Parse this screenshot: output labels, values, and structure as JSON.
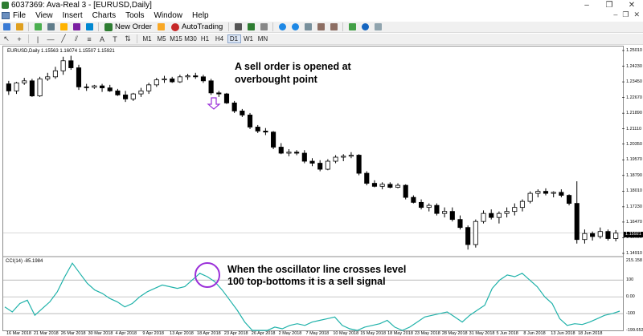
{
  "window": {
    "title": "6037369: Ava-Real 3 - [EURUSD,Daily]",
    "minimize": "–",
    "restore": "❐",
    "close": "✕"
  },
  "menu": {
    "items": [
      "File",
      "View",
      "Insert",
      "Charts",
      "Tools",
      "Window",
      "Help"
    ]
  },
  "toolbar": {
    "new_order": "New Order",
    "autotrading": "AutoTrading",
    "timeframes": [
      "M1",
      "M5",
      "M15",
      "M30",
      "H1",
      "H4",
      "D1",
      "W1",
      "MN"
    ],
    "active_timeframe": "D1"
  },
  "chart": {
    "info": "EURUSD,Daily  1.15563 1.16074 1.15507 1.15921",
    "cci_info": "CCI(14) -85.1984",
    "last_price": "1.15921",
    "annotation_top": [
      "A sell order is opened at",
      "overbought point"
    ],
    "annotation_bottom": [
      "When the oscillator line crosses level",
      "100 top-bottoms it is a sell signal"
    ],
    "price_ticks": [
      "1.25010",
      "1.24230",
      "1.23450",
      "1.22670",
      "1.21890",
      "1.21110",
      "1.20350",
      "1.19570",
      "1.18790",
      "1.18010",
      "1.17230",
      "1.16470",
      "1.15690",
      "1.14910"
    ],
    "cci_ticks": [
      "215.158",
      "100",
      "0.00",
      "-100",
      "-199.653"
    ],
    "date_ticks": [
      "16 Mar 2018",
      "21 Mar 2018",
      "26 Mar 2018",
      "30 Mar 2018",
      "4 Apr 2018",
      "9 Apr 2018",
      "13 Apr 2018",
      "18 Apr 2018",
      "23 Apr 2018",
      "26 Apr 2018",
      "2 May 2018",
      "7 May 2018",
      "10 May 2018",
      "15 May 2018",
      "18 May 2018",
      "23 May 2018",
      "28 May 2018",
      "31 May 2018",
      "5 Jun 2018",
      "8 Jun 2018",
      "13 Jun 2018",
      "18 Jun 2018"
    ]
  },
  "chart_data": {
    "type": "candlestick",
    "symbol": "EURUSD",
    "timeframe": "Daily",
    "ylim": [
      1.1491,
      1.2501
    ],
    "candles": [
      [
        1.2335,
        1.235,
        1.228,
        1.23
      ],
      [
        1.23,
        1.2345,
        1.2285,
        1.234
      ],
      [
        1.234,
        1.2365,
        1.233,
        1.235
      ],
      [
        1.235,
        1.236,
        1.227,
        1.2275
      ],
      [
        1.2275,
        1.237,
        1.227,
        1.236
      ],
      [
        1.236,
        1.239,
        1.235,
        1.237
      ],
      [
        1.237,
        1.242,
        1.236,
        1.24
      ],
      [
        1.24,
        1.247,
        1.238,
        1.245
      ],
      [
        1.245,
        1.2475,
        1.2405,
        1.2415
      ],
      [
        1.2415,
        1.243,
        1.2305,
        1.232
      ],
      [
        1.232,
        1.2335,
        1.23,
        1.2318
      ],
      [
        1.2318,
        1.233,
        1.231,
        1.2325
      ],
      [
        1.2325,
        1.2335,
        1.2295,
        1.2315
      ],
      [
        1.2315,
        1.233,
        1.2295,
        1.23
      ],
      [
        1.23,
        1.231,
        1.2275,
        1.228
      ],
      [
        1.228,
        1.23,
        1.2245,
        1.226
      ],
      [
        1.226,
        1.229,
        1.225,
        1.2285
      ],
      [
        1.2285,
        1.2315,
        1.227,
        1.23
      ],
      [
        1.23,
        1.234,
        1.2285,
        1.233
      ],
      [
        1.233,
        1.2365,
        1.232,
        1.2355
      ],
      [
        1.2355,
        1.2375,
        1.234,
        1.236
      ],
      [
        1.236,
        1.237,
        1.234,
        1.2345
      ],
      [
        1.2345,
        1.238,
        1.234,
        1.237
      ],
      [
        1.237,
        1.2385,
        1.2355,
        1.2375
      ],
      [
        1.2375,
        1.239,
        1.236,
        1.237
      ],
      [
        1.237,
        1.238,
        1.234,
        1.235
      ],
      [
        1.235,
        1.236,
        1.228,
        1.229
      ],
      [
        1.229,
        1.23,
        1.227,
        1.2285
      ],
      [
        1.2285,
        1.229,
        1.2235,
        1.224
      ],
      [
        1.224,
        1.225,
        1.219,
        1.22
      ],
      [
        1.22,
        1.221,
        1.217,
        1.218
      ],
      [
        1.218,
        1.219,
        1.211,
        1.212
      ],
      [
        1.212,
        1.213,
        1.209,
        1.21
      ],
      [
        1.21,
        1.2115,
        1.208,
        1.2095
      ],
      [
        1.2095,
        1.21,
        1.201,
        1.202
      ],
      [
        1.202,
        1.204,
        1.1985,
        1.199
      ],
      [
        1.199,
        1.201,
        1.1975,
        1.1995
      ],
      [
        1.1995,
        1.2005,
        1.198,
        1.199
      ],
      [
        1.199,
        1.2005,
        1.194,
        1.195
      ],
      [
        1.195,
        1.1965,
        1.1925,
        1.194
      ],
      [
        1.194,
        1.1955,
        1.19,
        1.191
      ],
      [
        1.191,
        1.196,
        1.1905,
        1.195
      ],
      [
        1.195,
        1.198,
        1.194,
        1.197
      ],
      [
        1.197,
        1.1985,
        1.195,
        1.1975
      ],
      [
        1.1975,
        1.1995,
        1.1965,
        1.198
      ],
      [
        1.198,
        1.1985,
        1.188,
        1.189
      ],
      [
        1.189,
        1.19,
        1.183,
        1.184
      ],
      [
        1.184,
        1.1855,
        1.182,
        1.1825
      ],
      [
        1.1825,
        1.1845,
        1.181,
        1.1835
      ],
      [
        1.1835,
        1.1845,
        1.1815,
        1.182
      ],
      [
        1.182,
        1.184,
        1.1815,
        1.183
      ],
      [
        1.183,
        1.1835,
        1.176,
        1.177
      ],
      [
        1.177,
        1.178,
        1.174,
        1.1745
      ],
      [
        1.1745,
        1.176,
        1.171,
        1.172
      ],
      [
        1.172,
        1.174,
        1.17,
        1.173
      ],
      [
        1.173,
        1.174,
        1.168,
        1.169
      ],
      [
        1.169,
        1.172,
        1.167,
        1.17
      ],
      [
        1.17,
        1.172,
        1.165,
        1.166
      ],
      [
        1.166,
        1.168,
        1.161,
        1.162
      ],
      [
        1.162,
        1.163,
        1.151,
        1.1535
      ],
      [
        1.1535,
        1.166,
        1.152,
        1.165
      ],
      [
        1.165,
        1.1705,
        1.164,
        1.169
      ],
      [
        1.169,
        1.171,
        1.166,
        1.167
      ],
      [
        1.167,
        1.17,
        1.164,
        1.169
      ],
      [
        1.169,
        1.172,
        1.167,
        1.17
      ],
      [
        1.17,
        1.174,
        1.168,
        1.172
      ],
      [
        1.172,
        1.176,
        1.17,
        1.175
      ],
      [
        1.175,
        1.18,
        1.174,
        1.179
      ],
      [
        1.179,
        1.181,
        1.177,
        1.18
      ],
      [
        1.18,
        1.1815,
        1.178,
        1.179
      ],
      [
        1.179,
        1.18,
        1.177,
        1.1795
      ],
      [
        1.1795,
        1.181,
        1.177,
        1.178
      ],
      [
        1.178,
        1.1785,
        1.173,
        1.174
      ],
      [
        1.174,
        1.185,
        1.154,
        1.156
      ],
      [
        1.156,
        1.161,
        1.154,
        1.159
      ],
      [
        1.159,
        1.16,
        1.1555,
        1.1575
      ],
      [
        1.1575,
        1.162,
        1.1565,
        1.16
      ],
      [
        1.16,
        1.161,
        1.1555,
        1.1565
      ],
      [
        1.1565,
        1.1607,
        1.1551,
        1.1592
      ]
    ],
    "cci": {
      "name": "CCI(14)",
      "levels": [
        100,
        0,
        -100
      ],
      "ylim": [
        -199.653,
        215.158
      ],
      "values": [
        -60,
        -90,
        -40,
        -20,
        -110,
        -70,
        -30,
        30,
        120,
        200,
        140,
        80,
        40,
        20,
        -10,
        -30,
        -60,
        -40,
        0,
        30,
        50,
        70,
        60,
        50,
        60,
        100,
        140,
        120,
        90,
        40,
        -20,
        -80,
        -150,
        -210,
        -230,
        -200,
        -180,
        -190,
        -170,
        -160,
        -170,
        -150,
        -140,
        -130,
        -120,
        -170,
        -190,
        -200,
        -180,
        -170,
        -160,
        -140,
        -180,
        -200,
        -180,
        -150,
        -120,
        -110,
        -100,
        -90,
        -120,
        -150,
        -110,
        -80,
        -50,
        50,
        100,
        130,
        120,
        140,
        100,
        60,
        0,
        -40,
        -130,
        -170,
        -160,
        -165,
        -150,
        -130,
        -110,
        -100,
        -85
      ]
    },
    "xlabel": "",
    "ylabel": ""
  }
}
